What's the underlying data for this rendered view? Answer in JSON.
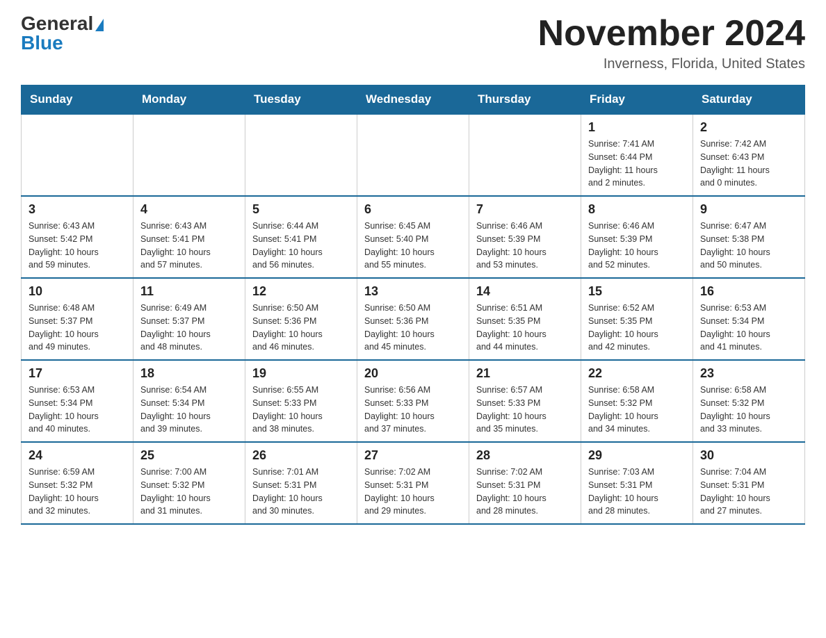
{
  "header": {
    "logo_general": "General",
    "logo_blue": "Blue",
    "title": "November 2024",
    "subtitle": "Inverness, Florida, United States"
  },
  "weekdays": [
    "Sunday",
    "Monday",
    "Tuesday",
    "Wednesday",
    "Thursday",
    "Friday",
    "Saturday"
  ],
  "weeks": [
    [
      {
        "day": "",
        "info": ""
      },
      {
        "day": "",
        "info": ""
      },
      {
        "day": "",
        "info": ""
      },
      {
        "day": "",
        "info": ""
      },
      {
        "day": "",
        "info": ""
      },
      {
        "day": "1",
        "info": "Sunrise: 7:41 AM\nSunset: 6:44 PM\nDaylight: 11 hours\nand 2 minutes."
      },
      {
        "day": "2",
        "info": "Sunrise: 7:42 AM\nSunset: 6:43 PM\nDaylight: 11 hours\nand 0 minutes."
      }
    ],
    [
      {
        "day": "3",
        "info": "Sunrise: 6:43 AM\nSunset: 5:42 PM\nDaylight: 10 hours\nand 59 minutes."
      },
      {
        "day": "4",
        "info": "Sunrise: 6:43 AM\nSunset: 5:41 PM\nDaylight: 10 hours\nand 57 minutes."
      },
      {
        "day": "5",
        "info": "Sunrise: 6:44 AM\nSunset: 5:41 PM\nDaylight: 10 hours\nand 56 minutes."
      },
      {
        "day": "6",
        "info": "Sunrise: 6:45 AM\nSunset: 5:40 PM\nDaylight: 10 hours\nand 55 minutes."
      },
      {
        "day": "7",
        "info": "Sunrise: 6:46 AM\nSunset: 5:39 PM\nDaylight: 10 hours\nand 53 minutes."
      },
      {
        "day": "8",
        "info": "Sunrise: 6:46 AM\nSunset: 5:39 PM\nDaylight: 10 hours\nand 52 minutes."
      },
      {
        "day": "9",
        "info": "Sunrise: 6:47 AM\nSunset: 5:38 PM\nDaylight: 10 hours\nand 50 minutes."
      }
    ],
    [
      {
        "day": "10",
        "info": "Sunrise: 6:48 AM\nSunset: 5:37 PM\nDaylight: 10 hours\nand 49 minutes."
      },
      {
        "day": "11",
        "info": "Sunrise: 6:49 AM\nSunset: 5:37 PM\nDaylight: 10 hours\nand 48 minutes."
      },
      {
        "day": "12",
        "info": "Sunrise: 6:50 AM\nSunset: 5:36 PM\nDaylight: 10 hours\nand 46 minutes."
      },
      {
        "day": "13",
        "info": "Sunrise: 6:50 AM\nSunset: 5:36 PM\nDaylight: 10 hours\nand 45 minutes."
      },
      {
        "day": "14",
        "info": "Sunrise: 6:51 AM\nSunset: 5:35 PM\nDaylight: 10 hours\nand 44 minutes."
      },
      {
        "day": "15",
        "info": "Sunrise: 6:52 AM\nSunset: 5:35 PM\nDaylight: 10 hours\nand 42 minutes."
      },
      {
        "day": "16",
        "info": "Sunrise: 6:53 AM\nSunset: 5:34 PM\nDaylight: 10 hours\nand 41 minutes."
      }
    ],
    [
      {
        "day": "17",
        "info": "Sunrise: 6:53 AM\nSunset: 5:34 PM\nDaylight: 10 hours\nand 40 minutes."
      },
      {
        "day": "18",
        "info": "Sunrise: 6:54 AM\nSunset: 5:34 PM\nDaylight: 10 hours\nand 39 minutes."
      },
      {
        "day": "19",
        "info": "Sunrise: 6:55 AM\nSunset: 5:33 PM\nDaylight: 10 hours\nand 38 minutes."
      },
      {
        "day": "20",
        "info": "Sunrise: 6:56 AM\nSunset: 5:33 PM\nDaylight: 10 hours\nand 37 minutes."
      },
      {
        "day": "21",
        "info": "Sunrise: 6:57 AM\nSunset: 5:33 PM\nDaylight: 10 hours\nand 35 minutes."
      },
      {
        "day": "22",
        "info": "Sunrise: 6:58 AM\nSunset: 5:32 PM\nDaylight: 10 hours\nand 34 minutes."
      },
      {
        "day": "23",
        "info": "Sunrise: 6:58 AM\nSunset: 5:32 PM\nDaylight: 10 hours\nand 33 minutes."
      }
    ],
    [
      {
        "day": "24",
        "info": "Sunrise: 6:59 AM\nSunset: 5:32 PM\nDaylight: 10 hours\nand 32 minutes."
      },
      {
        "day": "25",
        "info": "Sunrise: 7:00 AM\nSunset: 5:32 PM\nDaylight: 10 hours\nand 31 minutes."
      },
      {
        "day": "26",
        "info": "Sunrise: 7:01 AM\nSunset: 5:31 PM\nDaylight: 10 hours\nand 30 minutes."
      },
      {
        "day": "27",
        "info": "Sunrise: 7:02 AM\nSunset: 5:31 PM\nDaylight: 10 hours\nand 29 minutes."
      },
      {
        "day": "28",
        "info": "Sunrise: 7:02 AM\nSunset: 5:31 PM\nDaylight: 10 hours\nand 28 minutes."
      },
      {
        "day": "29",
        "info": "Sunrise: 7:03 AM\nSunset: 5:31 PM\nDaylight: 10 hours\nand 28 minutes."
      },
      {
        "day": "30",
        "info": "Sunrise: 7:04 AM\nSunset: 5:31 PM\nDaylight: 10 hours\nand 27 minutes."
      }
    ]
  ]
}
